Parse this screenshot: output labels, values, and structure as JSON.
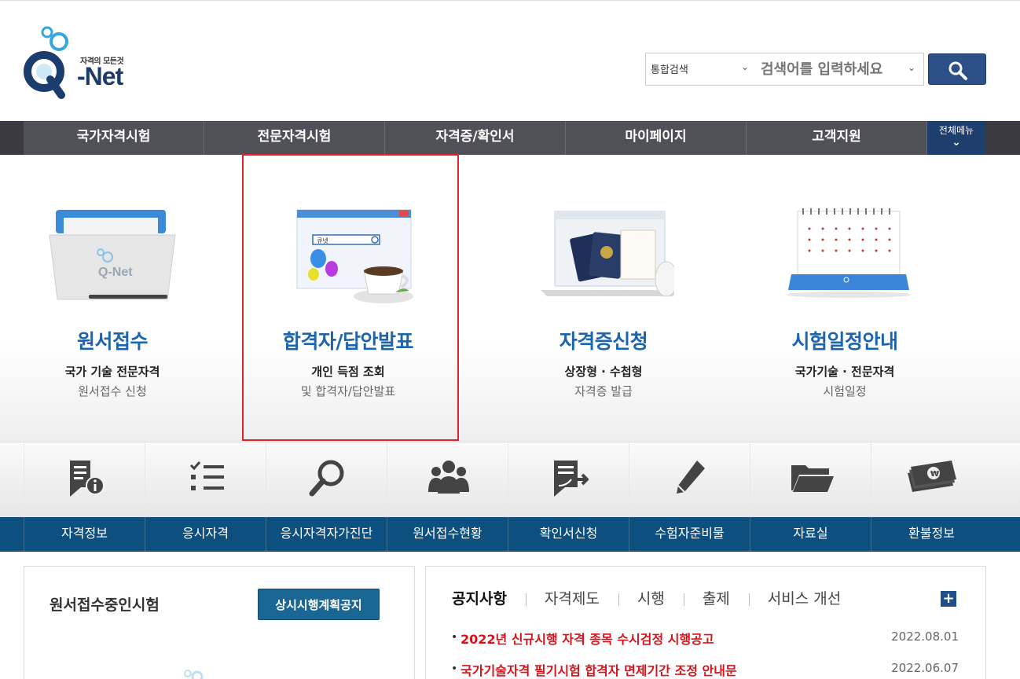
{
  "header": {
    "logo_tagline": "자격의 모든것",
    "logo_text": "-Net",
    "search": {
      "category": "통합검색",
      "placeholder": "검색어를 입력하세요"
    }
  },
  "gnb": {
    "items": [
      "국가자격시험",
      "전문자격시험",
      "자격증/확인서",
      "마이페이지",
      "고객지원"
    ],
    "all_menu": "전체메뉴"
  },
  "hero": {
    "cards": [
      {
        "title": "원서접수",
        "line1": "국가 기술 전문자격",
        "line2": "원서접수 신청"
      },
      {
        "title": "합격자/답안발표",
        "line1": "개인 득점 조회",
        "line2": "및 합격자/답안발표"
      },
      {
        "title": "자격증신청",
        "line1": "상장형 · 수첩형",
        "line2": "자격증 발급"
      },
      {
        "title": "시험일정안내",
        "line1": "국가기술 · 전문자격",
        "line2": "시험일정"
      }
    ],
    "illustration_text": {
      "qnet": "Q-Net",
      "search_box": "큐넷"
    }
  },
  "quick_menu": [
    {
      "label": "자격정보",
      "icon": "document-info-icon"
    },
    {
      "label": "응시자격",
      "icon": "checklist-icon"
    },
    {
      "label": "응시자격자가진단",
      "icon": "magnifier-icon"
    },
    {
      "label": "원서접수현황",
      "icon": "group-icon"
    },
    {
      "label": "확인서신청",
      "icon": "document-arrow-icon"
    },
    {
      "label": "수험자준비물",
      "icon": "pencil-icon"
    },
    {
      "label": "자료실",
      "icon": "folder-icon"
    },
    {
      "label": "환불정보",
      "icon": "money-icon"
    }
  ],
  "left_panel": {
    "title": "원서접수중인시험",
    "button": "상시시행계획공지"
  },
  "right_panel": {
    "tabs": [
      "공지사항",
      "자격제도",
      "시행",
      "출제",
      "서비스 개선"
    ],
    "more": "+",
    "notices": [
      {
        "title": "2022년 신규시행 자격 종목 수시검정 시행공고",
        "date": "2022.08.01"
      },
      {
        "title": "국가기술자격 필기시험 합격자 면제기간 조정 안내문",
        "date": "2022.06.07"
      }
    ]
  },
  "colors": {
    "gnb_bg": "#505058",
    "all_menu_bg": "#1e3f6e",
    "hero_title": "#1c65ae",
    "quick_label_bg": "#0d4f7e",
    "notice_text": "#d8121a",
    "highlight_border": "#e0242a"
  }
}
